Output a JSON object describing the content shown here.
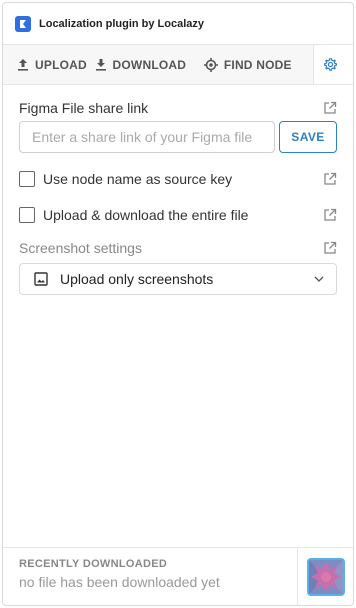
{
  "app": {
    "title": "Localization plugin by Localazy",
    "accent_color": "#2d7fc9",
    "logo_icon": "localazy-logo-icon"
  },
  "tabs": [
    {
      "label": "UPLOAD",
      "icon": "upload-icon"
    },
    {
      "label": "DOWNLOAD",
      "icon": "download-icon"
    },
    {
      "label": "FIND NODE",
      "icon": "crosshair-icon"
    },
    {
      "label": "",
      "icon": "gear-icon",
      "active": true
    }
  ],
  "settings": {
    "share_link": {
      "label": "Figma File share link",
      "placeholder": "Enter a share link of your Figma file",
      "value": "",
      "save_label": "SAVE"
    },
    "node_name_source_key": {
      "label": "Use node name as source key",
      "checked": false
    },
    "entire_file": {
      "label": "Upload & download the entire file",
      "checked": false
    },
    "screenshot": {
      "label": "Screenshot settings",
      "selected": "Upload only screenshots",
      "icon": "image-icon"
    }
  },
  "footer": {
    "heading": "RECENTLY DOWNLOADED",
    "text": "no file has been downloaded yet"
  }
}
